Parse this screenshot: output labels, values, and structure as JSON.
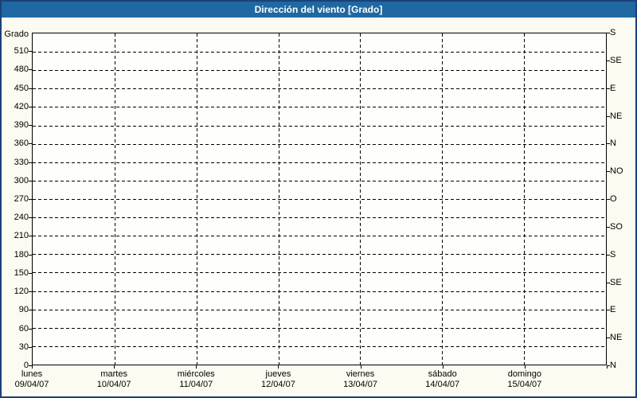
{
  "colors": {
    "titlebar_bg": "#1F68A1",
    "title_text": "#FFFFFF",
    "frame_border": "#1B4178",
    "background": "#FBFBF1",
    "plot_bg": "#FEFEFB",
    "grid": "#000000",
    "text": "#000000"
  },
  "chart_data": {
    "type": "line",
    "title": "Dirección del viento [Grado]",
    "grid": "dashed",
    "legend": "none",
    "series": [],
    "y_left_axis": {
      "label": "Grado",
      "min": 0,
      "max": 540,
      "tick_step": 30,
      "ticks": [
        {
          "value": 0,
          "label": "0"
        },
        {
          "value": 30,
          "label": "30"
        },
        {
          "value": 60,
          "label": "60"
        },
        {
          "value": 90,
          "label": "90"
        },
        {
          "value": 120,
          "label": "120"
        },
        {
          "value": 150,
          "label": "150"
        },
        {
          "value": 180,
          "label": "180"
        },
        {
          "value": 210,
          "label": "210"
        },
        {
          "value": 240,
          "label": "240"
        },
        {
          "value": 270,
          "label": "270"
        },
        {
          "value": 300,
          "label": "300"
        },
        {
          "value": 330,
          "label": "330"
        },
        {
          "value": 360,
          "label": "360"
        },
        {
          "value": 390,
          "label": "390"
        },
        {
          "value": 420,
          "label": "420"
        },
        {
          "value": 450,
          "label": "450"
        },
        {
          "value": 480,
          "label": "480"
        },
        {
          "value": 510,
          "label": "510"
        }
      ]
    },
    "y_right_axis": {
      "ticks": [
        {
          "value": 0,
          "label": "N"
        },
        {
          "value": 45,
          "label": "NE"
        },
        {
          "value": 90,
          "label": "E"
        },
        {
          "value": 135,
          "label": "SE"
        },
        {
          "value": 180,
          "label": "S"
        },
        {
          "value": 225,
          "label": "SO"
        },
        {
          "value": 270,
          "label": "O"
        },
        {
          "value": 315,
          "label": "NO"
        },
        {
          "value": 360,
          "label": "N"
        },
        {
          "value": 405,
          "label": "NE"
        },
        {
          "value": 450,
          "label": "E"
        },
        {
          "value": 495,
          "label": "SE"
        },
        {
          "value": 540,
          "label": "S"
        }
      ]
    },
    "x_axis": {
      "categories": [
        {
          "day": "lunes",
          "date": "09/04/07"
        },
        {
          "day": "martes",
          "date": "10/04/07"
        },
        {
          "day": "miércoles",
          "date": "11/04/07"
        },
        {
          "day": "jueves",
          "date": "12/04/07"
        },
        {
          "day": "viernes",
          "date": "13/04/07"
        },
        {
          "day": "sábado",
          "date": "14/04/07"
        },
        {
          "day": "domingo",
          "date": "15/04/07"
        }
      ]
    }
  }
}
